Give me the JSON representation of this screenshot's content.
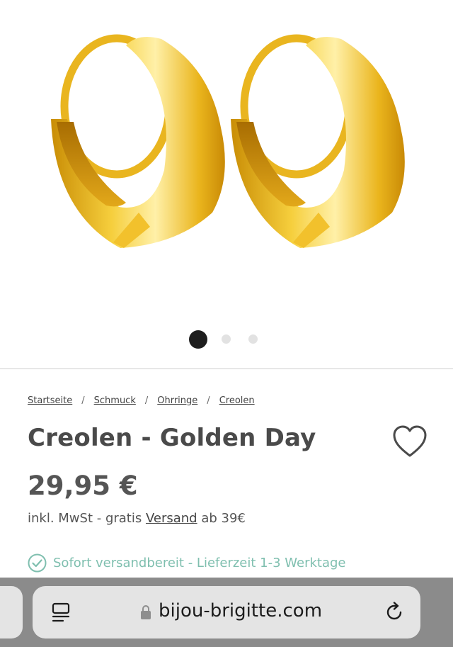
{
  "gallery": {
    "image": "gold-hoop-earrings-icon",
    "slide_count": 3,
    "active_slide": 1
  },
  "breadcrumb": {
    "items": [
      "Startseite",
      "Schmuck",
      "Ohrringe",
      "Creolen"
    ],
    "separator": "/"
  },
  "product": {
    "title": "Creolen - Golden Day",
    "price": "29,95 €",
    "tax_prefix": "inkl. MwSt - gratis ",
    "tax_link": "Versand",
    "tax_suffix": " ab 39€",
    "availability": "Sofort versandbereit - Lieferzeit 1-3 Werktage",
    "wishlist_icon": "heart-outline-icon"
  },
  "browser": {
    "url": "bijou-brigitte.com",
    "tabs_icon": "tabs-overview-icon",
    "lock_icon": "lock-icon",
    "reload_icon": "reload-icon"
  },
  "colors": {
    "availability": "#7fbfaf",
    "gold": "#e7b218",
    "toolbar": "#8b8b8b"
  }
}
